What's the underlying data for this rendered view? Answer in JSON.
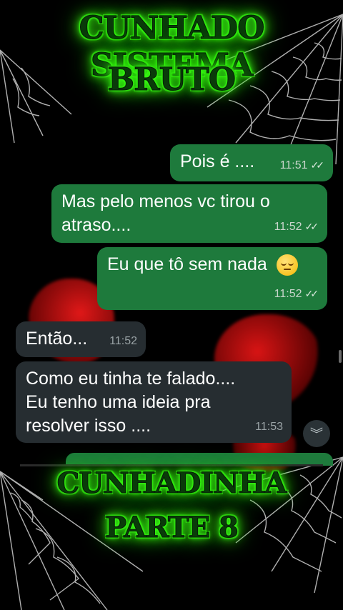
{
  "overlay_titles": {
    "top_line1": "CUNHADO SISTEMA",
    "top_line2": "BRUTO",
    "bottom_line1": "CUNHADINHA",
    "bottom_line2": "PARTE 8"
  },
  "messages": [
    {
      "text": "Pois é ....",
      "time": "11:51",
      "direction": "outgoing",
      "status": "read"
    },
    {
      "text_line1": "Mas pelo menos vc tirou o",
      "text_line2": "atraso....",
      "time": "11:52",
      "direction": "outgoing",
      "status": "read"
    },
    {
      "text": "Eu que tô sem nada",
      "emoji": "pensive-face",
      "time": "11:52",
      "direction": "outgoing",
      "status": "read"
    },
    {
      "text": "Então...",
      "time": "11:52",
      "direction": "incoming"
    },
    {
      "text_line1": "Como eu tinha te falado....",
      "text_line2": "Eu tenho uma ideia pra",
      "text_line3": "resolver isso ....",
      "time": "11:53",
      "direction": "incoming"
    }
  ],
  "icons": {
    "read_receipt": "double-check-icon",
    "scroll_down": "double-chevron-down-icon"
  },
  "colors": {
    "outgoing_bubble": "#1e7a3c",
    "incoming_bubble": "#262d31",
    "title_glow": "#39ff14"
  }
}
